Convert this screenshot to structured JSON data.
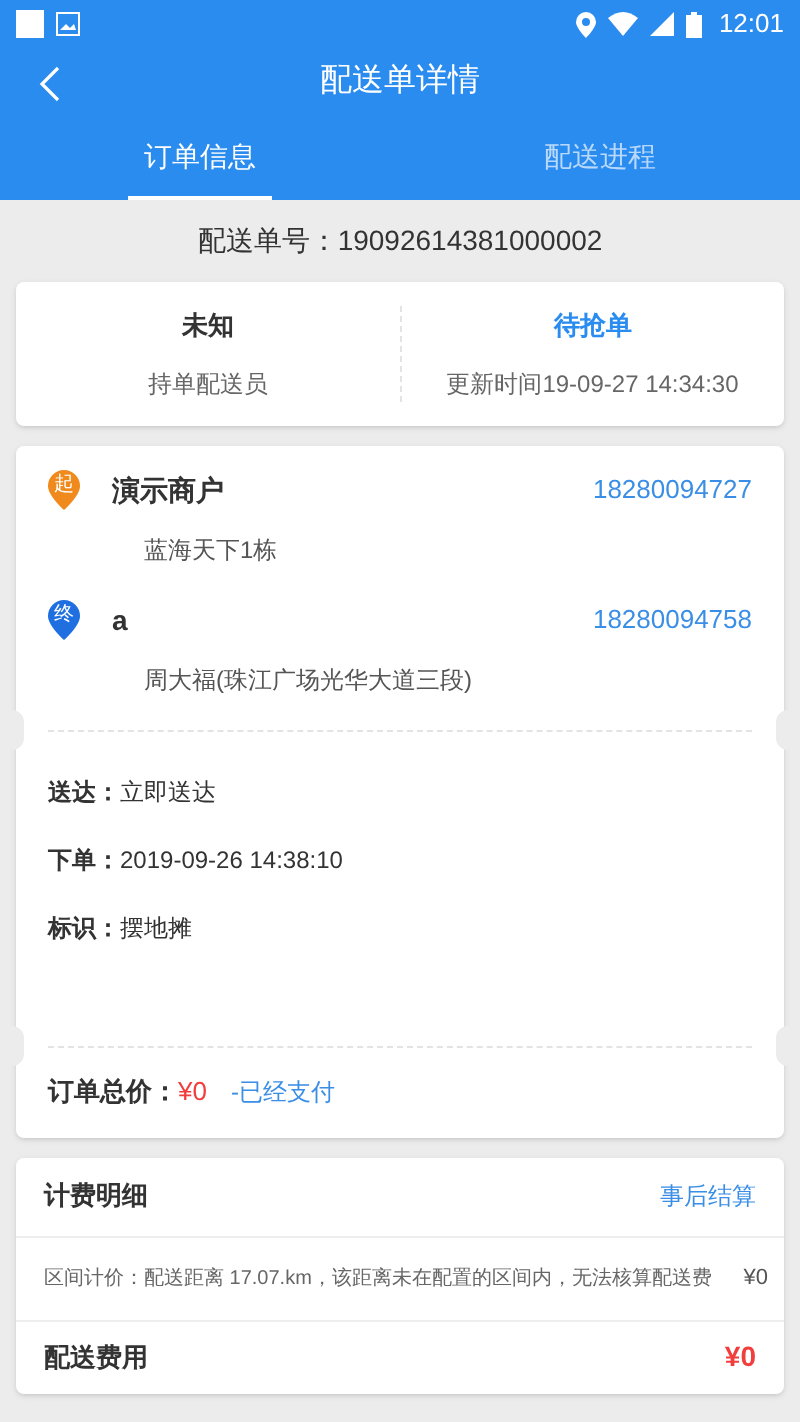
{
  "status_bar": {
    "time": "12:01"
  },
  "header": {
    "title": "配送单详情"
  },
  "tabs": [
    {
      "label": "订单信息",
      "selected": true
    },
    {
      "label": "配送进程",
      "selected": false
    }
  ],
  "order_number": "配送单号：19092614381000002",
  "summary": [
    {
      "value": "未知",
      "label": "持单配送员",
      "highlight": false
    },
    {
      "value": "待抢单",
      "label": "更新时间19-09-27 14:34:30",
      "highlight": true
    }
  ],
  "stops": [
    {
      "marker": "起",
      "color": "#f08a1c",
      "name": "演示商户",
      "phone": "18280094727",
      "address": "蓝海天下1栋"
    },
    {
      "marker": "终",
      "color": "#1f6fe0",
      "name": "a",
      "phone": "18280094758",
      "address": "周大福(珠江广场光华大道三段)"
    }
  ],
  "details": [
    {
      "label": "送达：",
      "value": "立即送达"
    },
    {
      "label": "下单：",
      "value": "2019-09-26 14:38:10"
    },
    {
      "label": "标识：",
      "value": "摆地摊"
    }
  ],
  "total": {
    "label": "订单总价：",
    "amount": "¥0",
    "status": "-已经支付"
  },
  "fees": {
    "title": "计费明细",
    "mode": "事后结算",
    "line": "区间计价：配送距离 17.07.km，该距离未在配置的区间内，无法核算配送费",
    "line_amount": "¥0",
    "total_label": "配送费用",
    "total_amount": "¥0"
  }
}
